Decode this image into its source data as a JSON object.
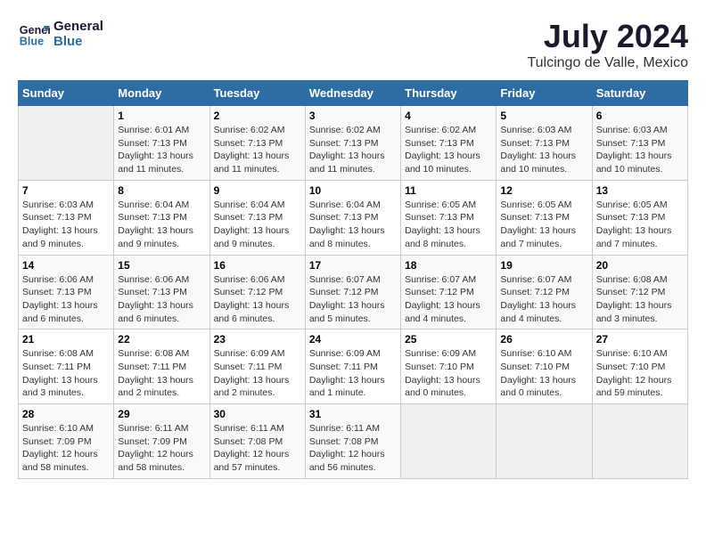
{
  "header": {
    "logo_line1": "General",
    "logo_line2": "Blue",
    "month_year": "July 2024",
    "location": "Tulcingo de Valle, Mexico"
  },
  "columns": [
    "Sunday",
    "Monday",
    "Tuesday",
    "Wednesday",
    "Thursday",
    "Friday",
    "Saturday"
  ],
  "weeks": [
    [
      {
        "day": "",
        "empty": true
      },
      {
        "day": "1",
        "sunrise": "6:01 AM",
        "sunset": "7:13 PM",
        "daylight": "13 hours and 11 minutes."
      },
      {
        "day": "2",
        "sunrise": "6:02 AM",
        "sunset": "7:13 PM",
        "daylight": "13 hours and 11 minutes."
      },
      {
        "day": "3",
        "sunrise": "6:02 AM",
        "sunset": "7:13 PM",
        "daylight": "13 hours and 11 minutes."
      },
      {
        "day": "4",
        "sunrise": "6:02 AM",
        "sunset": "7:13 PM",
        "daylight": "13 hours and 10 minutes."
      },
      {
        "day": "5",
        "sunrise": "6:03 AM",
        "sunset": "7:13 PM",
        "daylight": "13 hours and 10 minutes."
      },
      {
        "day": "6",
        "sunrise": "6:03 AM",
        "sunset": "7:13 PM",
        "daylight": "13 hours and 10 minutes."
      }
    ],
    [
      {
        "day": "7",
        "sunrise": "6:03 AM",
        "sunset": "7:13 PM",
        "daylight": "13 hours and 9 minutes."
      },
      {
        "day": "8",
        "sunrise": "6:04 AM",
        "sunset": "7:13 PM",
        "daylight": "13 hours and 9 minutes."
      },
      {
        "day": "9",
        "sunrise": "6:04 AM",
        "sunset": "7:13 PM",
        "daylight": "13 hours and 9 minutes."
      },
      {
        "day": "10",
        "sunrise": "6:04 AM",
        "sunset": "7:13 PM",
        "daylight": "13 hours and 8 minutes."
      },
      {
        "day": "11",
        "sunrise": "6:05 AM",
        "sunset": "7:13 PM",
        "daylight": "13 hours and 8 minutes."
      },
      {
        "day": "12",
        "sunrise": "6:05 AM",
        "sunset": "7:13 PM",
        "daylight": "13 hours and 7 minutes."
      },
      {
        "day": "13",
        "sunrise": "6:05 AM",
        "sunset": "7:13 PM",
        "daylight": "13 hours and 7 minutes."
      }
    ],
    [
      {
        "day": "14",
        "sunrise": "6:06 AM",
        "sunset": "7:13 PM",
        "daylight": "13 hours and 6 minutes."
      },
      {
        "day": "15",
        "sunrise": "6:06 AM",
        "sunset": "7:13 PM",
        "daylight": "13 hours and 6 minutes."
      },
      {
        "day": "16",
        "sunrise": "6:06 AM",
        "sunset": "7:12 PM",
        "daylight": "13 hours and 6 minutes."
      },
      {
        "day": "17",
        "sunrise": "6:07 AM",
        "sunset": "7:12 PM",
        "daylight": "13 hours and 5 minutes."
      },
      {
        "day": "18",
        "sunrise": "6:07 AM",
        "sunset": "7:12 PM",
        "daylight": "13 hours and 4 minutes."
      },
      {
        "day": "19",
        "sunrise": "6:07 AM",
        "sunset": "7:12 PM",
        "daylight": "13 hours and 4 minutes."
      },
      {
        "day": "20",
        "sunrise": "6:08 AM",
        "sunset": "7:12 PM",
        "daylight": "13 hours and 3 minutes."
      }
    ],
    [
      {
        "day": "21",
        "sunrise": "6:08 AM",
        "sunset": "7:11 PM",
        "daylight": "13 hours and 3 minutes."
      },
      {
        "day": "22",
        "sunrise": "6:08 AM",
        "sunset": "7:11 PM",
        "daylight": "13 hours and 2 minutes."
      },
      {
        "day": "23",
        "sunrise": "6:09 AM",
        "sunset": "7:11 PM",
        "daylight": "13 hours and 2 minutes."
      },
      {
        "day": "24",
        "sunrise": "6:09 AM",
        "sunset": "7:11 PM",
        "daylight": "13 hours and 1 minute."
      },
      {
        "day": "25",
        "sunrise": "6:09 AM",
        "sunset": "7:10 PM",
        "daylight": "13 hours and 0 minutes."
      },
      {
        "day": "26",
        "sunrise": "6:10 AM",
        "sunset": "7:10 PM",
        "daylight": "13 hours and 0 minutes."
      },
      {
        "day": "27",
        "sunrise": "6:10 AM",
        "sunset": "7:10 PM",
        "daylight": "12 hours and 59 minutes."
      }
    ],
    [
      {
        "day": "28",
        "sunrise": "6:10 AM",
        "sunset": "7:09 PM",
        "daylight": "12 hours and 58 minutes."
      },
      {
        "day": "29",
        "sunrise": "6:11 AM",
        "sunset": "7:09 PM",
        "daylight": "12 hours and 58 minutes."
      },
      {
        "day": "30",
        "sunrise": "6:11 AM",
        "sunset": "7:08 PM",
        "daylight": "12 hours and 57 minutes."
      },
      {
        "day": "31",
        "sunrise": "6:11 AM",
        "sunset": "7:08 PM",
        "daylight": "12 hours and 56 minutes."
      },
      {
        "day": "",
        "empty": true
      },
      {
        "day": "",
        "empty": true
      },
      {
        "day": "",
        "empty": true
      }
    ]
  ]
}
